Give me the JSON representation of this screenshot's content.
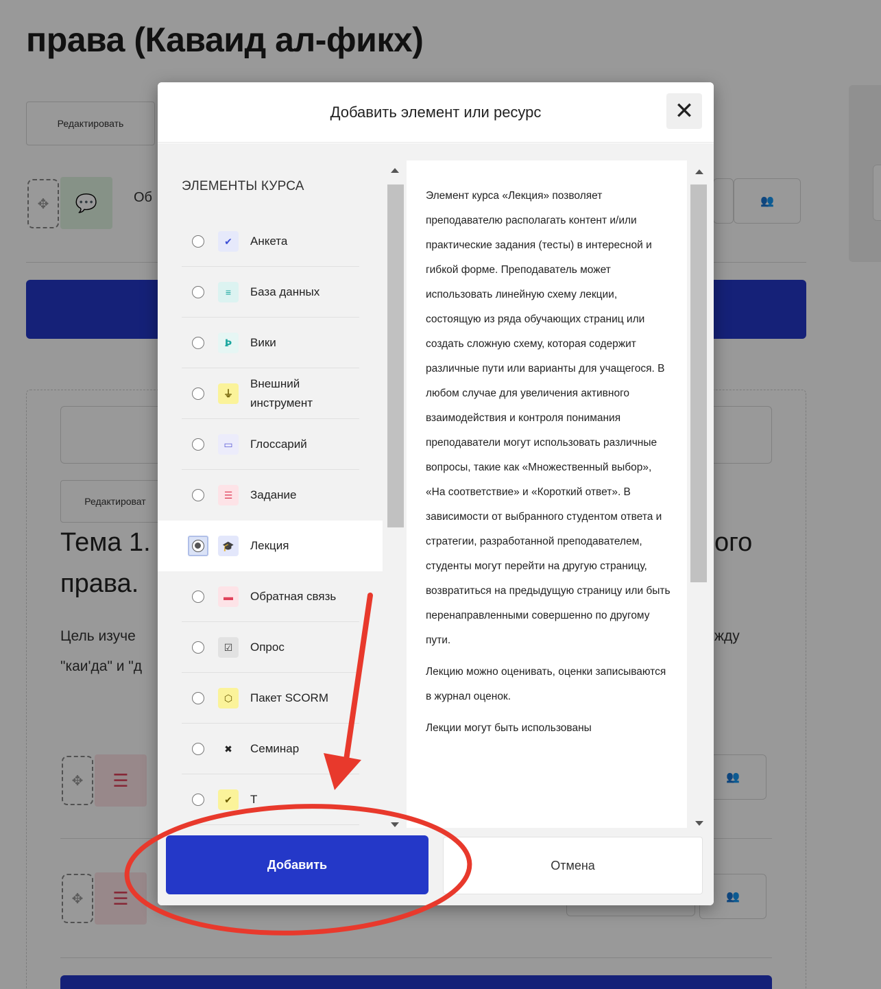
{
  "course": {
    "title": "права (Каваид ал-фикх)",
    "edit_button": "Редактировать",
    "edit_button_2": "Редактироват",
    "activity_label": "Об",
    "topic_title_line1": "Тема 1.",
    "topic_title_end": "ого",
    "topic_title_line2": "права.",
    "topic_text_line1": "Цель изуче",
    "topic_text_end": "жду",
    "topic_text_line2": "\"каи'да\" и \"д"
  },
  "modal": {
    "title": "Добавить элемент или ресурс",
    "close_glyph": "✕",
    "list_heading": "ЭЛЕМЕНТЫ КУРСА",
    "items": [
      {
        "label": "Анкета",
        "icon": "survey-icon",
        "color": "#3d4fd6",
        "bg": "#e6e9fb",
        "glyph": "✔"
      },
      {
        "label": "База данных",
        "icon": "database-icon",
        "color": "#1aa7a0",
        "bg": "#dcf3f1",
        "glyph": "≡"
      },
      {
        "label": "Вики",
        "icon": "wiki-icon",
        "color": "#1aa7a0",
        "bg": "#e6f6f4",
        "glyph": "Ꝧ"
      },
      {
        "label": "Внешний инструмент",
        "icon": "plugin-icon",
        "color": "#6b5b00",
        "bg": "#fbf39a",
        "glyph": "⏚"
      },
      {
        "label": "Глоссарий",
        "icon": "glossary-icon",
        "color": "#5a5ad6",
        "bg": "#ececfb",
        "glyph": "▭"
      },
      {
        "label": "Задание",
        "icon": "assignment-icon",
        "color": "#e0425b",
        "bg": "#fde3e7",
        "glyph": "☰"
      },
      {
        "label": "Лекция",
        "icon": "lesson-icon",
        "color": "#2a3fd0",
        "bg": "#e3e7fb",
        "glyph": "🎓"
      },
      {
        "label": "Обратная связь",
        "icon": "feedback-icon",
        "color": "#e0425b",
        "bg": "#fde3e7",
        "glyph": "▬"
      },
      {
        "label": "Опрос",
        "icon": "choice-icon",
        "color": "#333333",
        "bg": "#e2e2e2",
        "glyph": "☑"
      },
      {
        "label": "Пакет SCORM",
        "icon": "scorm-icon",
        "color": "#6b5b00",
        "bg": "#fbf39a",
        "glyph": "⬡"
      },
      {
        "label": "Семинар",
        "icon": "workshop-icon",
        "color": "#222222",
        "bg": "#f2f2f2",
        "glyph": "✖"
      },
      {
        "label": "Т",
        "icon": "quiz-icon",
        "color": "#6b5b00",
        "bg": "#fbf39a",
        "glyph": "✔"
      }
    ],
    "selected_index": 6,
    "description": [
      "Элемент курса «Лекция» позволяет преподавателю располагать контент и/или практические задания (тесты) в интересной и гибкой форме. Преподаватель может использовать линейную схему лекции, состоящую из ряда обучающих страниц или создать сложную схему, которая содержит различные пути или варианты для учащегося. В любом случае для увеличения активного взаимодействия и контроля понимания преподаватели могут использовать различные вопросы, такие как «Множественный выбор», «На соответствие» и «Короткий ответ». В зависимости от выбранного студентом ответа и стратегии, разработанной преподавателем, студенты могут перейти на другую страницу, возвратиться на предыдущую страницу или быть перенаправленными совершенно по другому пути.",
      "Лекцию можно оценивать, оценки записываются в журнал оценок.",
      "Лекции могут быть использованы"
    ],
    "add_button": "Добавить",
    "cancel_button": "Отмена"
  },
  "colors": {
    "primary": "#2438c8",
    "annotation": "#e8392c"
  }
}
